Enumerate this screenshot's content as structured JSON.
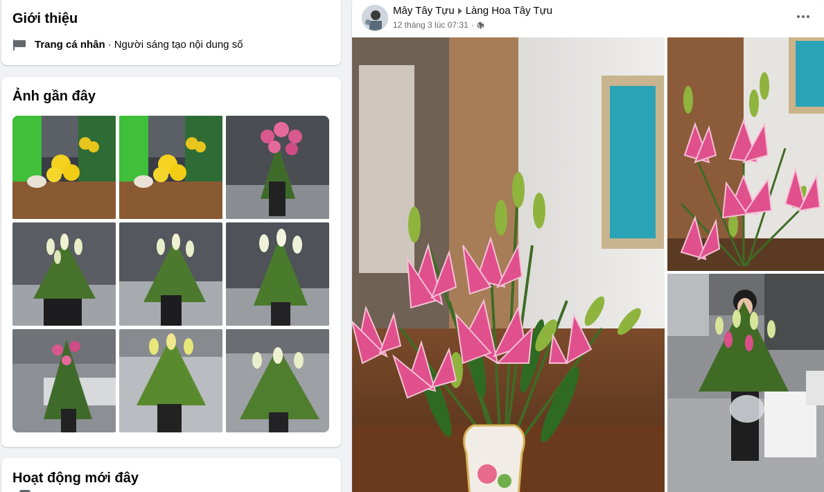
{
  "intro": {
    "title": "Giới thiệu",
    "page_type": "Trang cá nhân",
    "separator": "·",
    "category": "Người sáng tạo nội dung số",
    "icon": "flag-icon"
  },
  "recent_photos": {
    "title": "Ảnh gần đây",
    "count": 9
  },
  "recent_activity": {
    "title": "Hoạt động mới đây"
  },
  "post": {
    "author": "Mây Tây Tựu",
    "group": "Làng Hoa Tây Tựu",
    "timestamp": "12 tháng 3 lúc 07:31",
    "separator": "·",
    "privacy_icon": "globe-icon",
    "more_icon": "more-options-icon",
    "image_count": 3
  },
  "colors": {
    "background": "#f0f2f5",
    "card": "#ffffff",
    "secondary_text": "#65676b",
    "lily_pink": "#e0508c",
    "leaf_green": "#4f7a2c"
  }
}
